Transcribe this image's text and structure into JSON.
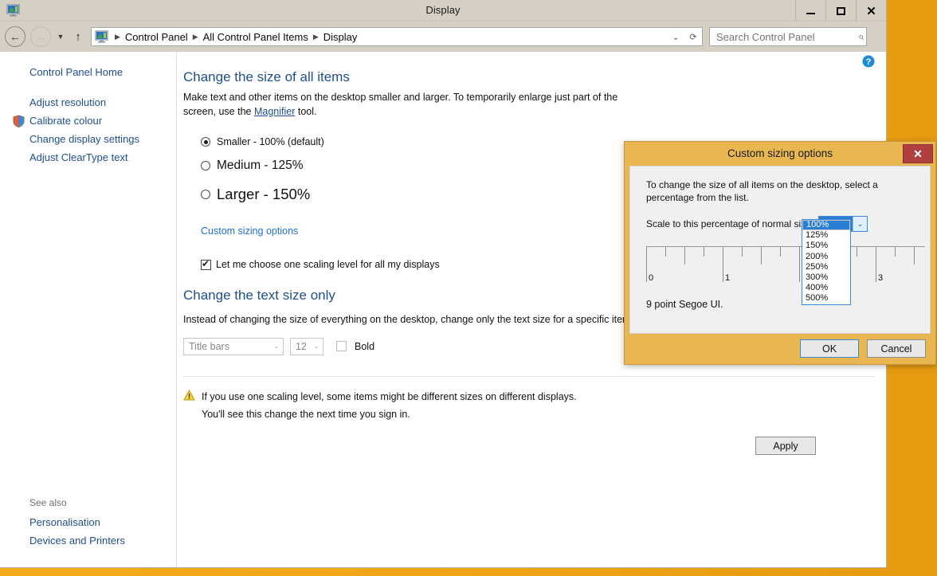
{
  "window": {
    "title": "Display",
    "app_icon": "display-monitor-icon",
    "minimize_label": "Minimize",
    "maximize_label": "Maximize",
    "close_label": "Close"
  },
  "nav": {
    "back_label": "Back",
    "forward_label": "Forward",
    "recent_label": "Recent pages",
    "up_label": "Up",
    "breadcrumbs": [
      "Control Panel",
      "All Control Panel Items",
      "Display"
    ],
    "dropdown_label": "Previous locations",
    "refresh_label": "Refresh"
  },
  "search": {
    "placeholder": "Search Control Panel",
    "value": ""
  },
  "sidebar": {
    "home": "Control Panel Home",
    "items": [
      {
        "label": "Adjust resolution",
        "shield": false
      },
      {
        "label": "Calibrate colour",
        "shield": true
      },
      {
        "label": "Change display settings",
        "shield": false
      },
      {
        "label": "Adjust ClearType text",
        "shield": false
      }
    ],
    "see_also_title": "See also",
    "see_also": [
      "Personalisation",
      "Devices and Printers"
    ]
  },
  "main": {
    "help_label": "Help",
    "heading": "Change the size of all items",
    "description_pre": "Make text and other items on the desktop smaller and larger. To temporarily enlarge just part of the screen, use the ",
    "description_link": "Magnifier",
    "description_post": " tool.",
    "scale_options": [
      {
        "label": "Smaller - 100% (default)",
        "selected": true
      },
      {
        "label": "Medium - 125%",
        "selected": false
      },
      {
        "label": "Larger - 150%",
        "selected": false
      }
    ],
    "custom_link": "Custom sizing options",
    "one_scaling_checkbox": {
      "label": "Let me choose one scaling level for all my displays",
      "checked": true
    },
    "text_heading": "Change the text size only",
    "text_description": "Instead of changing the size of everything on the desktop, change only the text size for a specific item.",
    "item_select": "Title bars",
    "size_select": "12",
    "bold_label": "Bold",
    "bold_checked": false,
    "warning_line1": "If you use one scaling level, some items might be different sizes on different displays.",
    "warning_line2": "You'll see this change the next time you sign in.",
    "apply_label": "Apply"
  },
  "dialog": {
    "title": "Custom sizing options",
    "close_label": "Close",
    "instruction": "To change the size of all items on the desktop, select a percentage from the list.",
    "scale_label": "Scale to this percentage of normal size:",
    "selected_value": "100%",
    "options": [
      "100%",
      "125%",
      "150%",
      "200%",
      "250%",
      "300%",
      "400%",
      "500%"
    ],
    "ruler_numbers": [
      "0",
      "1",
      "3"
    ],
    "sample_text": "9 point Segoe UI.",
    "ok_label": "OK",
    "cancel_label": "Cancel"
  },
  "colors": {
    "titlebar": "#d6d0c4",
    "accent_link": "#1f4f8c",
    "dialog_gold": "#e8b752",
    "close_red": "#b03f3f",
    "select_blue": "#2a7fd4",
    "desktop_orange": "#f0a617"
  }
}
